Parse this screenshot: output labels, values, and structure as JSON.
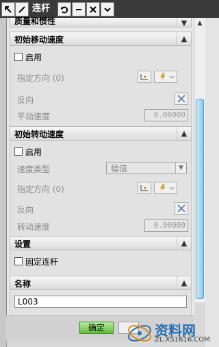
{
  "window": {
    "title": "连杆"
  },
  "sections": {
    "mass": {
      "label": "质量和惯性"
    },
    "init_move": {
      "label": "初始移动速度",
      "enable_label": "启用",
      "direction_label": "指定方向 (0)",
      "reverse_label": "反向",
      "speed_label": "平动速度",
      "speed_value": "0.00000"
    },
    "init_rot": {
      "label": "初始转动速度",
      "enable_label": "启用",
      "speed_type_label": "速度类型",
      "speed_type_value": "幅值",
      "direction_label": "指定方向 (0)",
      "reverse_label": "反向",
      "speed_label": "转动速度",
      "speed_value": "0.00000"
    },
    "settings": {
      "label": "设置",
      "fix_link_label": "固定连杆"
    },
    "name": {
      "label": "名称",
      "value": "L003"
    }
  },
  "buttons": {
    "ok": "确定"
  },
  "watermark": {
    "text": "资料网",
    "url": "ZL.XS1616.COM"
  },
  "icons": [
    "back-arrow-icon",
    "undo-icon",
    "minimize-icon",
    "close-icon",
    "chevron-up-icon",
    "chevron-down-icon",
    "vector-icon",
    "lightning-icon",
    "reverse-icon",
    "scroll-up-icon"
  ],
  "colors": {
    "titlebar": "#3a3a3a",
    "ok_button": "#5fbf3b",
    "scroll_thumb": "#8fc7e8",
    "watermark": "#2a6fb0"
  }
}
